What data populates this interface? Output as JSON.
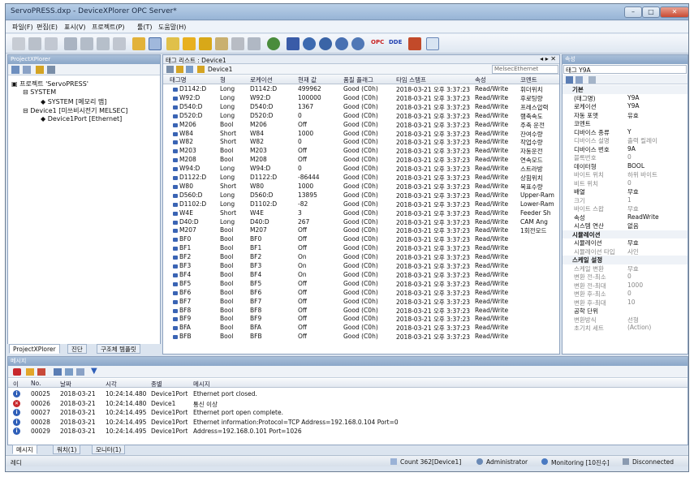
{
  "window": {
    "title": "ServoPRESS.dxp - DeviceXPlorer OPC Server*"
  },
  "menu": [
    "파일(F)",
    "편집(E)",
    "표시(V)",
    "프로젝트(P)",
    "툴(T)",
    "도움말(H)"
  ],
  "toolbar": {
    "opc_label": "OPC",
    "dde_label": "DDE"
  },
  "project_panel": {
    "title": "ProjectXPlorer",
    "tree": [
      {
        "label": "프로젝트 'ServoPRESS'",
        "level": 0
      },
      {
        "label": "SYSTEM",
        "level": 1
      },
      {
        "label": "SYSTEM [메모리 맵]",
        "level": 2
      },
      {
        "label": "Device1 [미쓰비시전기 MELSEC]",
        "level": 1
      },
      {
        "label": "Device1Port [Ethernet]",
        "level": 2
      }
    ],
    "tabs": [
      "ProjectXPlorer",
      "진단",
      "구조체 템플릿"
    ]
  },
  "tag_panel": {
    "title": "태그 리스트 : Device1",
    "path": "Device1",
    "device_label": "MelsecEthernet",
    "columns": [
      "태그명",
      "형",
      "로케이션",
      "현재 값",
      "품질 플래그",
      "타임 스탬프",
      "속성",
      "코멘트"
    ],
    "rows": [
      [
        "D1142:D",
        "Long",
        "D1142:D",
        "499962",
        "Good (C0h)",
        "2018-03-21 오후 3:37:23",
        "Read/Write",
        "휘더위치"
      ],
      [
        "W92:D",
        "Long",
        "W92:D",
        "100000",
        "Good (C0h)",
        "2018-03-21 오후 3:37:23",
        "Read/Write",
        "후로팅량"
      ],
      [
        "D540:D",
        "Long",
        "D540:D",
        "1367",
        "Good (C0h)",
        "2018-03-21 오후 3:37:23",
        "Read/Write",
        "프레스압력"
      ],
      [
        "D520:D",
        "Long",
        "D520:D",
        "0",
        "Good (C0h)",
        "2018-03-21 오후 3:37:23",
        "Read/Write",
        "램축속도"
      ],
      [
        "M206",
        "Bool",
        "M206",
        "Off",
        "Good (C0h)",
        "2018-03-21 오후 3:37:23",
        "Read/Write",
        "주축 운전"
      ],
      [
        "W84",
        "Short",
        "W84",
        "1000",
        "Good (C0h)",
        "2018-03-21 오후 3:37:23",
        "Read/Write",
        "잔여수량"
      ],
      [
        "W82",
        "Short",
        "W82",
        "0",
        "Good (C0h)",
        "2018-03-21 오후 3:37:23",
        "Read/Write",
        "작업수량"
      ],
      [
        "M203",
        "Bool",
        "M203",
        "Off",
        "Good (C0h)",
        "2018-03-21 오후 3:37:23",
        "Read/Write",
        "자동운전"
      ],
      [
        "M208",
        "Bool",
        "M208",
        "Off",
        "Good (C0h)",
        "2018-03-21 오후 3:37:23",
        "Read/Write",
        "연속모드"
      ],
      [
        "W94:D",
        "Long",
        "W94:D",
        "0",
        "Good (C0h)",
        "2018-03-21 오후 3:37:23",
        "Read/Write",
        "스트라방"
      ],
      [
        "D1122:D",
        "Long",
        "D1122:D",
        "-86444",
        "Good (C0h)",
        "2018-03-21 오후 3:37:23",
        "Read/Write",
        "상힘위치"
      ],
      [
        "W80",
        "Short",
        "W80",
        "1000",
        "Good (C0h)",
        "2018-03-21 오후 3:37:23",
        "Read/Write",
        "목표수량"
      ],
      [
        "D560:D",
        "Long",
        "D560:D",
        "13895",
        "Good (C0h)",
        "2018-03-21 오후 3:37:23",
        "Read/Write",
        "Upper-Ram"
      ],
      [
        "D1102:D",
        "Long",
        "D1102:D",
        "-82",
        "Good (C0h)",
        "2018-03-21 오후 3:37:23",
        "Read/Write",
        "Lower-Ram"
      ],
      [
        "W4E",
        "Short",
        "W4E",
        "3",
        "Good (C0h)",
        "2018-03-21 오후 3:37:23",
        "Read/Write",
        "Feeder Sh"
      ],
      [
        "D40:D",
        "Long",
        "D40:D",
        "267",
        "Good (C0h)",
        "2018-03-21 오후 3:37:23",
        "Read/Write",
        "CAM Ang"
      ],
      [
        "M207",
        "Bool",
        "M207",
        "Off",
        "Good (C0h)",
        "2018-03-21 오후 3:37:23",
        "Read/Write",
        "1회전모드"
      ],
      [
        "BF0",
        "Bool",
        "BF0",
        "Off",
        "Good (C0h)",
        "2018-03-21 오후 3:37:23",
        "Read/Write",
        ""
      ],
      [
        "BF1",
        "Bool",
        "BF1",
        "Off",
        "Good (C0h)",
        "2018-03-21 오후 3:37:23",
        "Read/Write",
        ""
      ],
      [
        "BF2",
        "Bool",
        "BF2",
        "On",
        "Good (C0h)",
        "2018-03-21 오후 3:37:23",
        "Read/Write",
        ""
      ],
      [
        "BF3",
        "Bool",
        "BF3",
        "On",
        "Good (C0h)",
        "2018-03-21 오후 3:37:23",
        "Read/Write",
        ""
      ],
      [
        "BF4",
        "Bool",
        "BF4",
        "On",
        "Good (C0h)",
        "2018-03-21 오후 3:37:23",
        "Read/Write",
        ""
      ],
      [
        "BF5",
        "Bool",
        "BF5",
        "Off",
        "Good (C0h)",
        "2018-03-21 오후 3:37:23",
        "Read/Write",
        ""
      ],
      [
        "BF6",
        "Bool",
        "BF6",
        "Off",
        "Good (C0h)",
        "2018-03-21 오후 3:37:23",
        "Read/Write",
        ""
      ],
      [
        "BF7",
        "Bool",
        "BF7",
        "Off",
        "Good (C0h)",
        "2018-03-21 오후 3:37:23",
        "Read/Write",
        ""
      ],
      [
        "BF8",
        "Bool",
        "BF8",
        "Off",
        "Good (C0h)",
        "2018-03-21 오후 3:37:23",
        "Read/Write",
        ""
      ],
      [
        "BF9",
        "Bool",
        "BF9",
        "Off",
        "Good (C0h)",
        "2018-03-21 오후 3:37:23",
        "Read/Write",
        ""
      ],
      [
        "BFA",
        "Bool",
        "BFA",
        "Off",
        "Good (C0h)",
        "2018-03-21 오후 3:37:23",
        "Read/Write",
        ""
      ],
      [
        "BFB",
        "Bool",
        "BFB",
        "Off",
        "Good (C0h)",
        "2018-03-21 오후 3:37:23",
        "Read/Write",
        ""
      ]
    ]
  },
  "props_panel": {
    "title": "속성",
    "selected": "태그  Y9A",
    "rows": [
      {
        "k": "기본",
        "v": "",
        "cat": true
      },
      {
        "k": "(태그명)",
        "v": "Y9A"
      },
      {
        "k": "로케이션",
        "v": "Y9A"
      },
      {
        "k": "자동 포맷",
        "v": "유효"
      },
      {
        "k": "코멘트",
        "v": ""
      },
      {
        "k": "디바이스 종류",
        "v": "Y"
      },
      {
        "k": "디바이스 설명",
        "v": "출력 릴레이",
        "muted": true
      },
      {
        "k": "디바이스 번호",
        "v": "9A"
      },
      {
        "k": "블록번호",
        "v": "0",
        "muted": true
      },
      {
        "k": "데이터형",
        "v": "BOOL"
      },
      {
        "k": "바이트 위치",
        "v": "하위 바이트",
        "muted": true
      },
      {
        "k": "비트 위치",
        "v": "0",
        "muted": true
      },
      {
        "k": "배열",
        "v": "무효"
      },
      {
        "k": "크기",
        "v": "1",
        "muted": true
      },
      {
        "k": "바이트 스왑",
        "v": "무효",
        "muted": true
      },
      {
        "k": "속성",
        "v": "ReadWrite"
      },
      {
        "k": "시스템 연산",
        "v": "없음"
      },
      {
        "k": "시뮬레이션",
        "v": "",
        "cat": true
      },
      {
        "k": "시뮬레이션",
        "v": "무효"
      },
      {
        "k": "시뮬레이션 타입",
        "v": "사인",
        "muted": true
      },
      {
        "k": "스케일 설정",
        "v": "",
        "cat": true
      },
      {
        "k": "스케일 변환",
        "v": "무효",
        "muted": true
      },
      {
        "k": "변환 전-최소",
        "v": "0",
        "muted": true
      },
      {
        "k": "변환 전-최대",
        "v": "1000",
        "muted": true
      },
      {
        "k": "변환 후-최소",
        "v": "0",
        "muted": true
      },
      {
        "k": "변환 후-최대",
        "v": "10",
        "muted": true
      },
      {
        "k": "공학 단위",
        "v": ""
      },
      {
        "k": "변환방식",
        "v": "선형",
        "muted": true
      },
      {
        "k": "초기치 세트",
        "v": "(Action)",
        "muted": true
      }
    ]
  },
  "messages": {
    "title": "메시지",
    "columns": [
      "이",
      "No.",
      "날짜",
      "시각",
      "종별",
      "메시지"
    ],
    "rows": [
      {
        "type": "info",
        "no": "00025",
        "date": "2018-03-21",
        "time": "10:24:14.480",
        "kind": "Device1Port",
        "msg": "Ethernet port closed."
      },
      {
        "type": "error",
        "no": "00026",
        "date": "2018-03-21",
        "time": "10:24:14.480",
        "kind": "Device1",
        "msg": "통신 이상"
      },
      {
        "type": "info",
        "no": "00027",
        "date": "2018-03-21",
        "time": "10:24:14.495",
        "kind": "Device1Port",
        "msg": "Ethernet port open complete."
      },
      {
        "type": "info",
        "no": "00028",
        "date": "2018-03-21",
        "time": "10:24:14.495",
        "kind": "Device1Port",
        "msg": "Ethernet information:Protocol=TCP Address=192.168.0.104 Port=0"
      },
      {
        "type": "info",
        "no": "00029",
        "date": "2018-03-21",
        "time": "10:24:14.495",
        "kind": "Device1Port",
        "msg": "Address=192.168.0.101 Port=1026"
      }
    ],
    "tabs": [
      "메시지",
      "워치(1)",
      "모니터(1)"
    ]
  },
  "status": {
    "ready": "레디",
    "count": "Count 362[Device1]",
    "user": "Administrator",
    "monitoring": "Monitoring [10진수]",
    "connection": "Disconnected"
  },
  "colors": {
    "accent": "#3a64b4",
    "error": "#c8282c",
    "info": "#2f5fb8"
  }
}
